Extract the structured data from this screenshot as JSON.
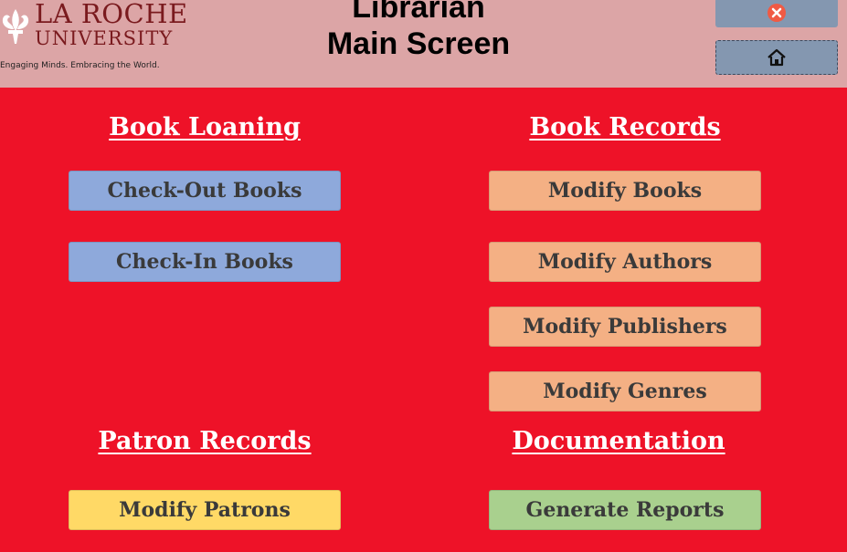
{
  "header": {
    "logo": {
      "name_line1": "LA ROCHE",
      "name_line2": "UNIVERSITY",
      "tagline": "Engaging Minds. Embracing the World."
    },
    "title_line1": "Librarian",
    "title_line2": "Main Screen",
    "close_icon": "close-x-circle",
    "home_icon": "home"
  },
  "sections": {
    "book_loaning": {
      "title": "Book Loaning",
      "checkout": "Check-Out Books",
      "checkin": "Check-In Books"
    },
    "book_records": {
      "title": "Book Records",
      "modify_books": "Modify Books",
      "modify_authors": "Modify Authors",
      "modify_publishers": "Modify Publishers",
      "modify_genres": "Modify Genres"
    },
    "patron_records": {
      "title": "Patron Records",
      "modify_patrons": "Modify Patrons"
    },
    "documentation": {
      "title": "Documentation",
      "generate_reports": "Generate Reports"
    }
  },
  "colors": {
    "background": "#EE1228",
    "header": "#DCA5A6",
    "loaning_button": "#8EA9DB",
    "records_button": "#F4B084",
    "patron_button": "#FFD966",
    "docs_button": "#A9D08E",
    "header_button": "#8497B0"
  }
}
